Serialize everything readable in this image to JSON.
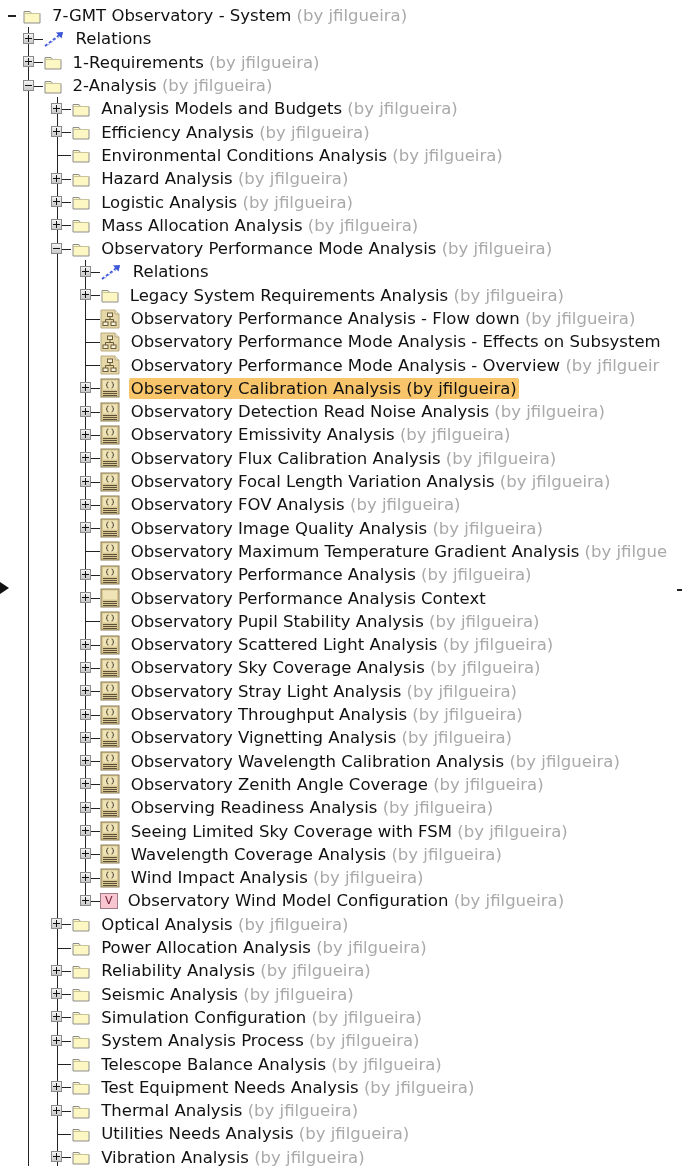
{
  "tree": {
    "root": {
      "label": "7-GMT Observatory - System",
      "owner": "(by jfilgueira)",
      "kind": "folder",
      "expandable": true,
      "expanded": true,
      "selected": false,
      "children": [
        {
          "label": "Relations",
          "kind": "relations",
          "expandable": true,
          "expanded": false,
          "selected": false
        },
        {
          "label": "1-Requirements",
          "owner": "(by jfilgueira)",
          "kind": "folder",
          "expandable": true,
          "expanded": false,
          "selected": false
        },
        {
          "label": "2-Analysis",
          "owner": "(by jfilgueira)",
          "kind": "folder",
          "expandable": true,
          "expanded": true,
          "selected": false,
          "children": [
            {
              "label": "Analysis Models and Budgets",
              "owner": "(by jfilgueira)",
              "kind": "folder",
              "expandable": true,
              "expanded": false,
              "selected": false
            },
            {
              "label": "Efficiency Analysis",
              "owner": "(by jfilgueira)",
              "kind": "folder",
              "expandable": true,
              "expanded": false,
              "selected": false
            },
            {
              "label": "Environmental Conditions Analysis",
              "owner": "(by jfilgueira)",
              "kind": "folder",
              "expandable": false,
              "selected": false
            },
            {
              "label": "Hazard Analysis",
              "owner": "(by jfilgueira)",
              "kind": "folder",
              "expandable": true,
              "expanded": false,
              "selected": false
            },
            {
              "label": "Logistic Analysis",
              "owner": "(by jfilgueira)",
              "kind": "folder",
              "expandable": true,
              "expanded": false,
              "selected": false
            },
            {
              "label": "Mass Allocation Analysis",
              "owner": "(by jfilgueira)",
              "kind": "folder",
              "expandable": true,
              "expanded": false,
              "selected": false
            },
            {
              "label": "Observatory Performance Mode Analysis",
              "owner": "(by jfilgueira)",
              "kind": "folder",
              "expandable": true,
              "expanded": true,
              "selected": false,
              "children": [
                {
                  "label": "Relations",
                  "kind": "relations",
                  "expandable": true,
                  "expanded": false,
                  "selected": false
                },
                {
                  "label": "Legacy System Requirements Analysis",
                  "owner": "(by jfilgueira)",
                  "kind": "folder",
                  "expandable": true,
                  "expanded": false,
                  "selected": false
                },
                {
                  "label": "Observatory Performance Analysis - Flow down",
                  "owner": "(by jfilgueira)",
                  "kind": "diagram",
                  "expandable": false,
                  "selected": false
                },
                {
                  "label": "Observatory Performance Mode Analysis - Effects on Subsystem",
                  "kind": "diagram",
                  "expandable": false,
                  "selected": false
                },
                {
                  "label": "Observatory Performance Mode Analysis - Overview",
                  "owner": "(by jfilgueir",
                  "kind": "diagram",
                  "expandable": false,
                  "selected": false
                },
                {
                  "label": "Observatory Calibration Analysis",
                  "owner": "(by jfilgueira)",
                  "kind": "block",
                  "expandable": true,
                  "expanded": false,
                  "selected": true
                },
                {
                  "label": "Observatory Detection Read Noise Analysis",
                  "owner": "(by jfilgueira)",
                  "kind": "block",
                  "expandable": true,
                  "expanded": false,
                  "selected": false
                },
                {
                  "label": "Observatory Emissivity Analysis",
                  "owner": "(by jfilgueira)",
                  "kind": "block",
                  "expandable": true,
                  "expanded": false,
                  "selected": false
                },
                {
                  "label": "Observatory Flux Calibration Analysis",
                  "owner": "(by jfilgueira)",
                  "kind": "block",
                  "expandable": true,
                  "expanded": false,
                  "selected": false
                },
                {
                  "label": "Observatory Focal Length Variation Analysis",
                  "owner": "(by jfilgueira)",
                  "kind": "block",
                  "expandable": true,
                  "expanded": false,
                  "selected": false
                },
                {
                  "label": "Observatory FOV Analysis",
                  "owner": "(by jfilgueira)",
                  "kind": "block",
                  "expandable": true,
                  "expanded": false,
                  "selected": false
                },
                {
                  "label": "Observatory Image Quality Analysis",
                  "owner": "(by jfilgueira)",
                  "kind": "block",
                  "expandable": true,
                  "expanded": false,
                  "selected": false
                },
                {
                  "label": "Observatory Maximum Temperature Gradient Analysis",
                  "owner": "(by jfilgue",
                  "kind": "block",
                  "expandable": false,
                  "selected": false
                },
                {
                  "label": "Observatory Performance  Analysis",
                  "owner": "(by jfilgueira)",
                  "kind": "block",
                  "expandable": true,
                  "expanded": false,
                  "selected": false
                },
                {
                  "label": "Observatory Performance Analysis Context",
                  "kind": "context",
                  "expandable": true,
                  "expanded": false,
                  "selected": false
                },
                {
                  "label": "Observatory Pupil Stability Analysis",
                  "owner": "(by jfilgueira)",
                  "kind": "block",
                  "expandable": false,
                  "selected": false
                },
                {
                  "label": "Observatory Scattered Light Analysis",
                  "owner": "(by jfilgueira)",
                  "kind": "block",
                  "expandable": true,
                  "expanded": false,
                  "selected": false
                },
                {
                  "label": "Observatory Sky Coverage Analysis",
                  "owner": "(by jfilgueira)",
                  "kind": "block",
                  "expandable": true,
                  "expanded": false,
                  "selected": false
                },
                {
                  "label": "Observatory Stray Light Analysis",
                  "owner": "(by jfilgueira)",
                  "kind": "block",
                  "expandable": true,
                  "expanded": false,
                  "selected": false
                },
                {
                  "label": "Observatory Throughput Analysis",
                  "owner": "(by jfilgueira)",
                  "kind": "block",
                  "expandable": true,
                  "expanded": false,
                  "selected": false
                },
                {
                  "label": "Observatory Vignetting Analysis",
                  "owner": "(by jfilgueira)",
                  "kind": "block",
                  "expandable": true,
                  "expanded": false,
                  "selected": false
                },
                {
                  "label": "Observatory Wavelength Calibration Analysis",
                  "owner": "(by jfilgueira)",
                  "kind": "block",
                  "expandable": true,
                  "expanded": false,
                  "selected": false
                },
                {
                  "label": "Observatory Zenith Angle Coverage",
                  "owner": "(by jfilgueira)",
                  "kind": "block",
                  "expandable": true,
                  "expanded": false,
                  "selected": false
                },
                {
                  "label": "Observing Readiness Analysis",
                  "owner": "(by jfilgueira)",
                  "kind": "block",
                  "expandable": true,
                  "expanded": false,
                  "selected": false
                },
                {
                  "label": "Seeing Limited Sky Coverage with FSM",
                  "owner": "(by jfilgueira)",
                  "kind": "block",
                  "expandable": true,
                  "expanded": false,
                  "selected": false
                },
                {
                  "label": "Wavelength Coverage Analysis",
                  "owner": "(by jfilgueira)",
                  "kind": "block",
                  "expandable": true,
                  "expanded": false,
                  "selected": false
                },
                {
                  "label": "Wind Impact  Analysis",
                  "owner": "(by jfilgueira)",
                  "kind": "block",
                  "expandable": true,
                  "expanded": false,
                  "selected": false
                },
                {
                  "label": "Observatory Wind Model Configuration",
                  "owner": "(by jfilgueira)",
                  "kind": "value",
                  "icon_text": "V",
                  "expandable": true,
                  "expanded": false,
                  "selected": false
                }
              ]
            },
            {
              "label": "Optical Analysis",
              "owner": "(by jfilgueira)",
              "kind": "folder",
              "expandable": true,
              "expanded": false,
              "selected": false
            },
            {
              "label": "Power Allocation Analysis",
              "owner": "(by jfilgueira)",
              "kind": "folder",
              "expandable": false,
              "selected": false
            },
            {
              "label": "Reliability Analysis",
              "owner": "(by jfilgueira)",
              "kind": "folder",
              "expandable": true,
              "expanded": false,
              "selected": false
            },
            {
              "label": "Seismic Analysis",
              "owner": "(by jfilgueira)",
              "kind": "folder",
              "expandable": true,
              "expanded": false,
              "selected": false
            },
            {
              "label": "Simulation Configuration",
              "owner": "(by jfilgueira)",
              "kind": "folder",
              "expandable": true,
              "expanded": false,
              "selected": false
            },
            {
              "label": "System Analysis Process",
              "owner": "(by jfilgueira)",
              "kind": "folder",
              "expandable": true,
              "expanded": false,
              "selected": false
            },
            {
              "label": "Telescope Balance Analysis",
              "owner": "(by jfilgueira)",
              "kind": "folder",
              "expandable": false,
              "selected": false
            },
            {
              "label": "Test Equipment Needs Analysis",
              "owner": "(by jfilgueira)",
              "kind": "folder",
              "expandable": true,
              "expanded": false,
              "selected": false
            },
            {
              "label": "Thermal Analysis",
              "owner": "(by jfilgueira)",
              "kind": "folder",
              "expandable": true,
              "expanded": false,
              "selected": false
            },
            {
              "label": "Utilities Needs Analysis",
              "owner": "(by jfilgueira)",
              "kind": "folder",
              "expandable": false,
              "selected": false
            },
            {
              "label": "Vibration Analysis",
              "owner": "(by jfilgueira)",
              "kind": "folder",
              "expandable": true,
              "expanded": false,
              "selected": false
            }
          ]
        }
      ]
    }
  }
}
